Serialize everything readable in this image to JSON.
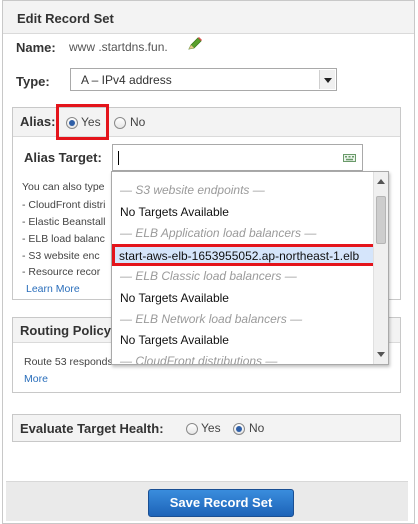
{
  "panel": {
    "title": "Edit Record Set"
  },
  "name": {
    "label": "Name:",
    "value": "www .startdns.fun."
  },
  "type": {
    "label": "Type:",
    "selected": "A – IPv4 address"
  },
  "alias": {
    "label": "Alias:",
    "options": [
      {
        "label": "Yes",
        "selected": true
      },
      {
        "label": "No",
        "selected": false
      }
    ],
    "target_label": "Alias Target:",
    "target_value": "",
    "description_lines": [
      "You can also type",
      "- CloudFront distri",
      "- Elastic Beanstall",
      "- ELB load balanc",
      "- S3 website enc",
      "- Resource recor"
    ],
    "learn_more": "Learn More"
  },
  "dropdown": {
    "items": [
      {
        "kind": "group",
        "text": "— S3 website endpoints —"
      },
      {
        "kind": "option",
        "text": "No Targets Available"
      },
      {
        "kind": "group",
        "text": "— ELB Application load balancers —"
      },
      {
        "kind": "selected",
        "text": "start-aws-elb-1653955052.ap-northeast-1.elb"
      },
      {
        "kind": "group",
        "text": "— ELB Classic load balancers —"
      },
      {
        "kind": "option",
        "text": "No Targets Available"
      },
      {
        "kind": "group",
        "text": "— ELB Network load balancers —"
      },
      {
        "kind": "option",
        "text": "No Targets Available"
      },
      {
        "kind": "group",
        "text": "— CloudFront distributions —"
      }
    ]
  },
  "routing": {
    "title": "Routing Policy",
    "description": "Route 53 responds",
    "more": "More"
  },
  "evaluate": {
    "label": "Evaluate Target Health:",
    "options": [
      {
        "label": "Yes",
        "selected": false
      },
      {
        "label": "No",
        "selected": true
      }
    ]
  },
  "footer": {
    "save_label": "Save Record Set"
  },
  "colors": {
    "accent": "#1d63b8",
    "highlight_border": "#e4141b",
    "link": "#2a6ebb"
  }
}
